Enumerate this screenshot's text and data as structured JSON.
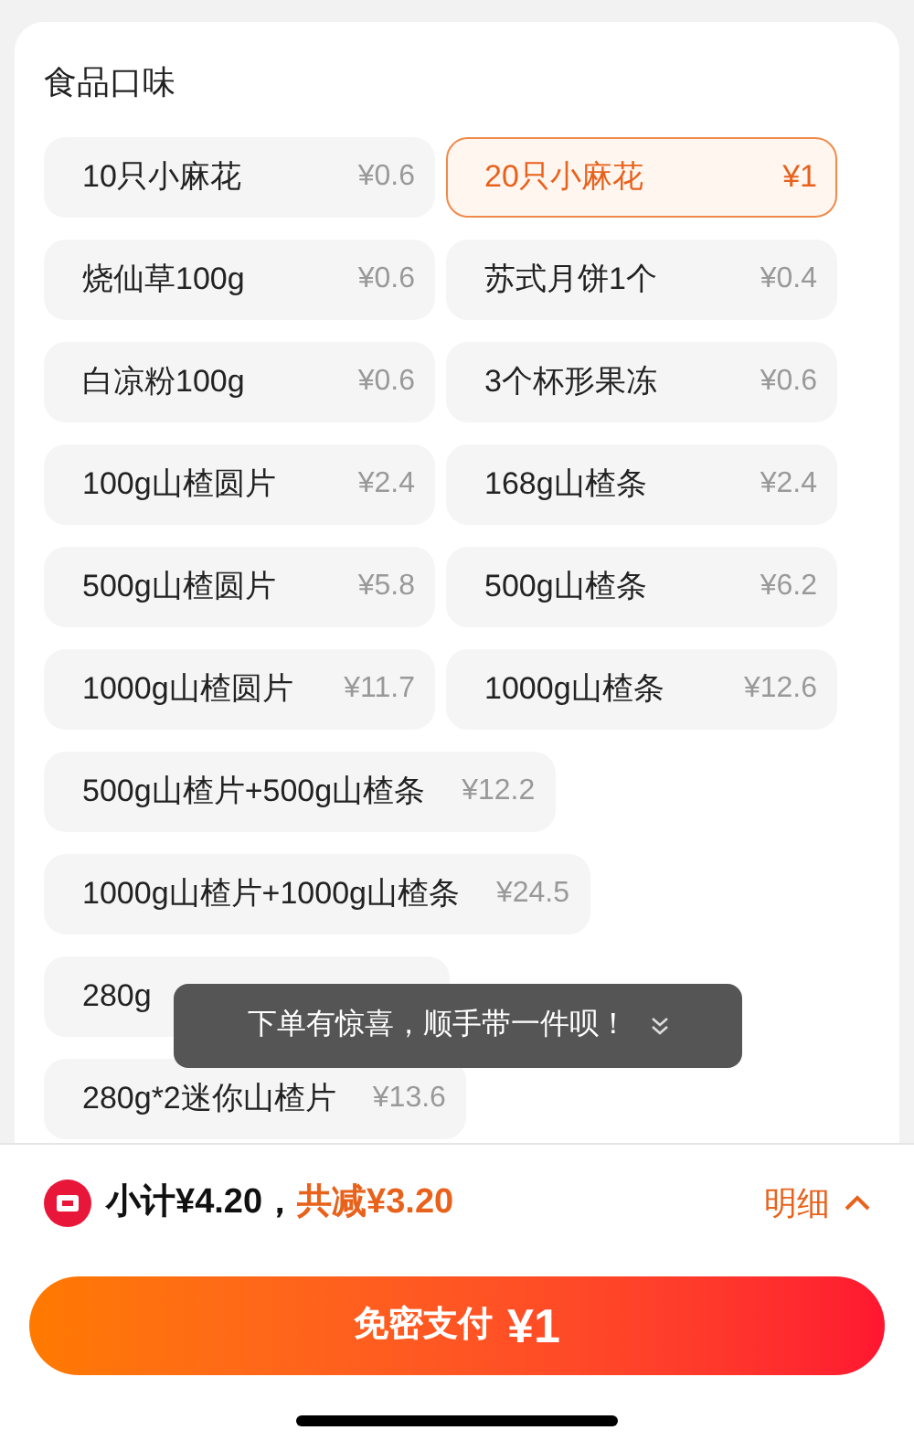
{
  "section": {
    "title": "食品口味",
    "options": [
      {
        "label": "10只小麻花",
        "price": "¥0.6",
        "selected": false
      },
      {
        "label": "20只小麻花",
        "price": "¥1",
        "selected": true
      },
      {
        "label": "烧仙草100g",
        "price": "¥0.6",
        "selected": false
      },
      {
        "label": "苏式月饼1个",
        "price": "¥0.4",
        "selected": false
      },
      {
        "label": "白凉粉100g",
        "price": "¥0.6",
        "selected": false
      },
      {
        "label": "3个杯形果冻",
        "price": "¥0.6",
        "selected": false
      },
      {
        "label": "100g山楂圆片",
        "price": "¥2.4",
        "selected": false
      },
      {
        "label": "168g山楂条",
        "price": "¥2.4",
        "selected": false
      },
      {
        "label": "500g山楂圆片",
        "price": "¥5.8",
        "selected": false
      },
      {
        "label": "500g山楂条",
        "price": "¥6.2",
        "selected": false
      },
      {
        "label": "1000g山楂圆片",
        "price": "¥11.7",
        "selected": false
      },
      {
        "label": "1000g山楂条",
        "price": "¥12.6",
        "selected": false
      },
      {
        "label": "500g山楂片+500g山楂条",
        "price": "¥12.2",
        "selected": false
      },
      {
        "label": "1000g山楂片+1000g山楂条",
        "price": "¥24.5",
        "selected": false
      },
      {
        "label": "280g",
        "selected": false
      },
      {
        "label": "280g*2迷你山楂片",
        "price": "¥13.6",
        "selected": false
      }
    ]
  },
  "toast": {
    "text": "下单有惊喜，顺手带一件呗！"
  },
  "summary": {
    "subtotal": "小计¥4.20，",
    "discount": "共减¥3.20",
    "details": "明细"
  },
  "pay_button": {
    "label": "免密支付",
    "amount": "¥1"
  }
}
